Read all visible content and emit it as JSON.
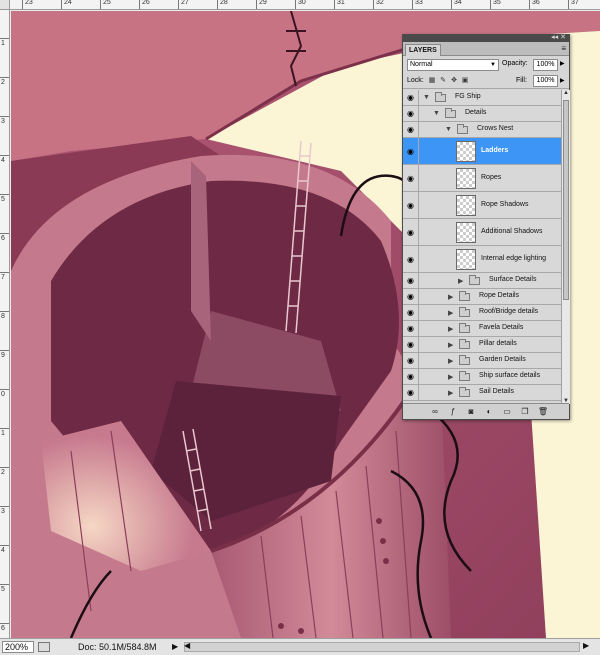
{
  "ruler": {
    "top_labels": [
      "23",
      "24",
      "25",
      "26",
      "27",
      "28",
      "29",
      "30",
      "31",
      "32",
      "33",
      "34",
      "35",
      "36",
      "37"
    ],
    "left_labels": [
      "1",
      "2",
      "3",
      "4",
      "5",
      "6",
      "7",
      "8",
      "9",
      "0",
      "1",
      "2",
      "3",
      "4",
      "5",
      "6"
    ]
  },
  "layers_panel": {
    "tab_label": "LAYERS",
    "blend_mode": "Normal",
    "opacity_label": "Opacity:",
    "opacity_value": "100%",
    "lock_label": "Lock:",
    "fill_label": "Fill:",
    "fill_value": "100%",
    "layers": [
      {
        "name": "FG Ship"
      },
      {
        "name": "Details"
      },
      {
        "name": "Crows Nest"
      },
      {
        "name": "Ladders"
      },
      {
        "name": "Ropes"
      },
      {
        "name": "Rope Shadows"
      },
      {
        "name": "Additional Shadows"
      },
      {
        "name": "Internal edge lighting"
      },
      {
        "name": "Surface Details"
      },
      {
        "name": "Rope Details"
      },
      {
        "name": "Roof/Bridge details"
      },
      {
        "name": "Favela Details"
      },
      {
        "name": "Pillar details"
      },
      {
        "name": "Garden Details"
      },
      {
        "name": "Ship surface details"
      },
      {
        "name": "Sail Details"
      }
    ],
    "footer_icons": [
      "link-icon",
      "fx-icon",
      "mask-icon",
      "adjustment-icon",
      "group-icon",
      "new-layer-icon",
      "trash-icon"
    ]
  },
  "status_bar": {
    "zoom": "200%",
    "doc_info": "Doc: 50.1M/584.8M"
  },
  "colors": {
    "canvas_bg": "#9e4a66",
    "selected_layer": "#3d95f5",
    "sky_cream": "#fbf5d6"
  }
}
